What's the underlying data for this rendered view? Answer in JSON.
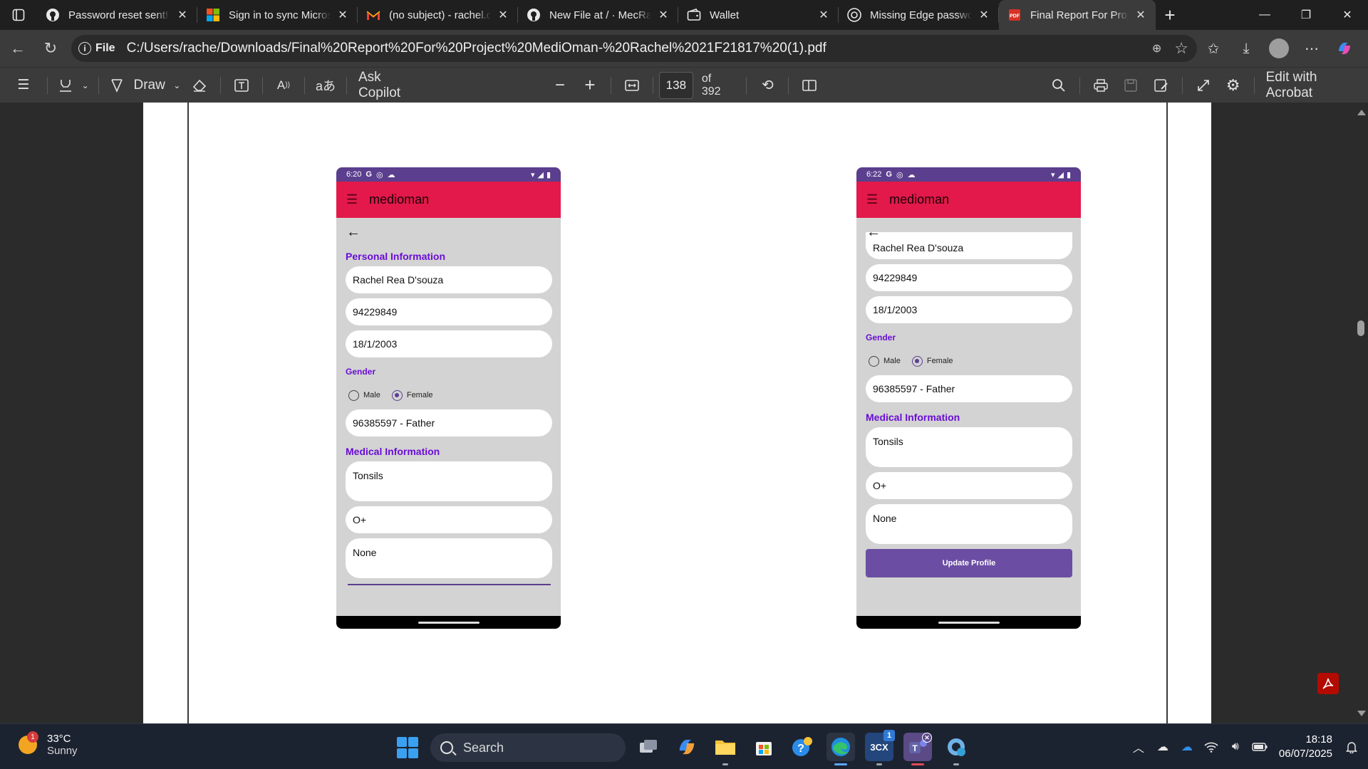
{
  "tabs": [
    {
      "title": "Password reset sent! · GitHub",
      "icon": "github-icon"
    },
    {
      "title": "Sign in to sync Microsoft",
      "icon": "microsoft-icon"
    },
    {
      "title": "(no subject) - rachel.ds",
      "icon": "gmail-icon"
    },
    {
      "title": "New File at / · MecRachel",
      "icon": "github-icon"
    },
    {
      "title": "Wallet",
      "icon": "wallet-icon"
    },
    {
      "title": "Missing Edge passwords",
      "icon": "edge-icon"
    },
    {
      "title": "Final Report For Project",
      "icon": "pdf-icon",
      "active": true
    }
  ],
  "address": {
    "scheme_label": "File",
    "url": "C:/Users/rache/Downloads/Final%20Report%20For%20Project%20MediOman-%20Rachel%2021F21817%20(1).pdf"
  },
  "pdf_toolbar": {
    "draw_label": "Draw",
    "copilot_label": "Ask Copilot",
    "page_current": "138",
    "page_total": "of 392",
    "edit_label": "Edit with Acrobat"
  },
  "phone_left": {
    "time": "6:20",
    "app_title": "medioman",
    "section_personal": "Personal Information",
    "name": "Rachel Rea D'souza",
    "phone": "94229849",
    "dob": "18/1/2003",
    "gender_label": "Gender",
    "gender_male": "Male",
    "gender_female": "Female",
    "emergency": "96385597 - Father",
    "section_medical": "Medical Information",
    "allergy": "Tonsils",
    "blood": "O+",
    "other": "None"
  },
  "phone_right": {
    "time": "6:22",
    "app_title": "medioman",
    "name": "Rachel Rea D'souza",
    "phone": "94229849",
    "dob": "18/1/2003",
    "gender_label": "Gender",
    "gender_male": "Male",
    "gender_female": "Female",
    "emergency": "96385597 - Father",
    "section_medical": "Medical Information",
    "allergy": "Tonsils",
    "blood": "O+",
    "other": "None",
    "update_button": "Update Profile"
  },
  "taskbar": {
    "weather_temp": "33°C",
    "weather_desc": "Sunny",
    "weather_badge": "1",
    "search_placeholder": "Search",
    "time": "18:18",
    "date": "06/07/2025",
    "teams_badge": "1"
  },
  "colors": {
    "app_bar": "#e2194a",
    "status_bar": "#5b3e8e",
    "section_text": "#6a0dd6",
    "update_button": "#6b4ea3"
  }
}
